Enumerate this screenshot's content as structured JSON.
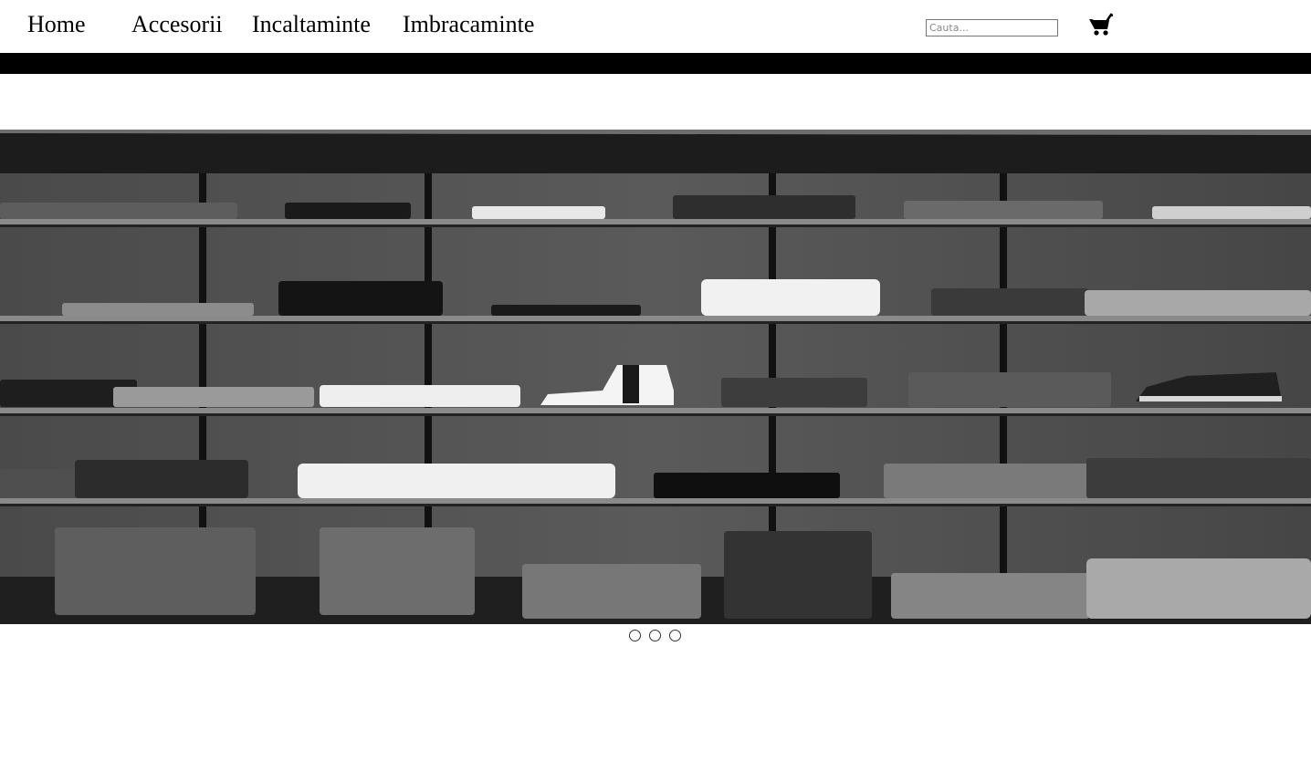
{
  "nav": {
    "items": [
      {
        "label": "Home"
      },
      {
        "label": "Accesorii"
      },
      {
        "label": "Incaltaminte"
      },
      {
        "label": "Imbracaminte"
      }
    ]
  },
  "search": {
    "placeholder": "Cauta...",
    "value": ""
  },
  "cart": {
    "icon": "cart-icon"
  },
  "hero": {
    "image": "clothing-shelves-photo",
    "style": "black-and-white"
  },
  "carousel": {
    "slide_count": 3,
    "active_index": null
  },
  "colors": {
    "background": "#ffffff",
    "bar": "#000000",
    "text": "#000000"
  }
}
